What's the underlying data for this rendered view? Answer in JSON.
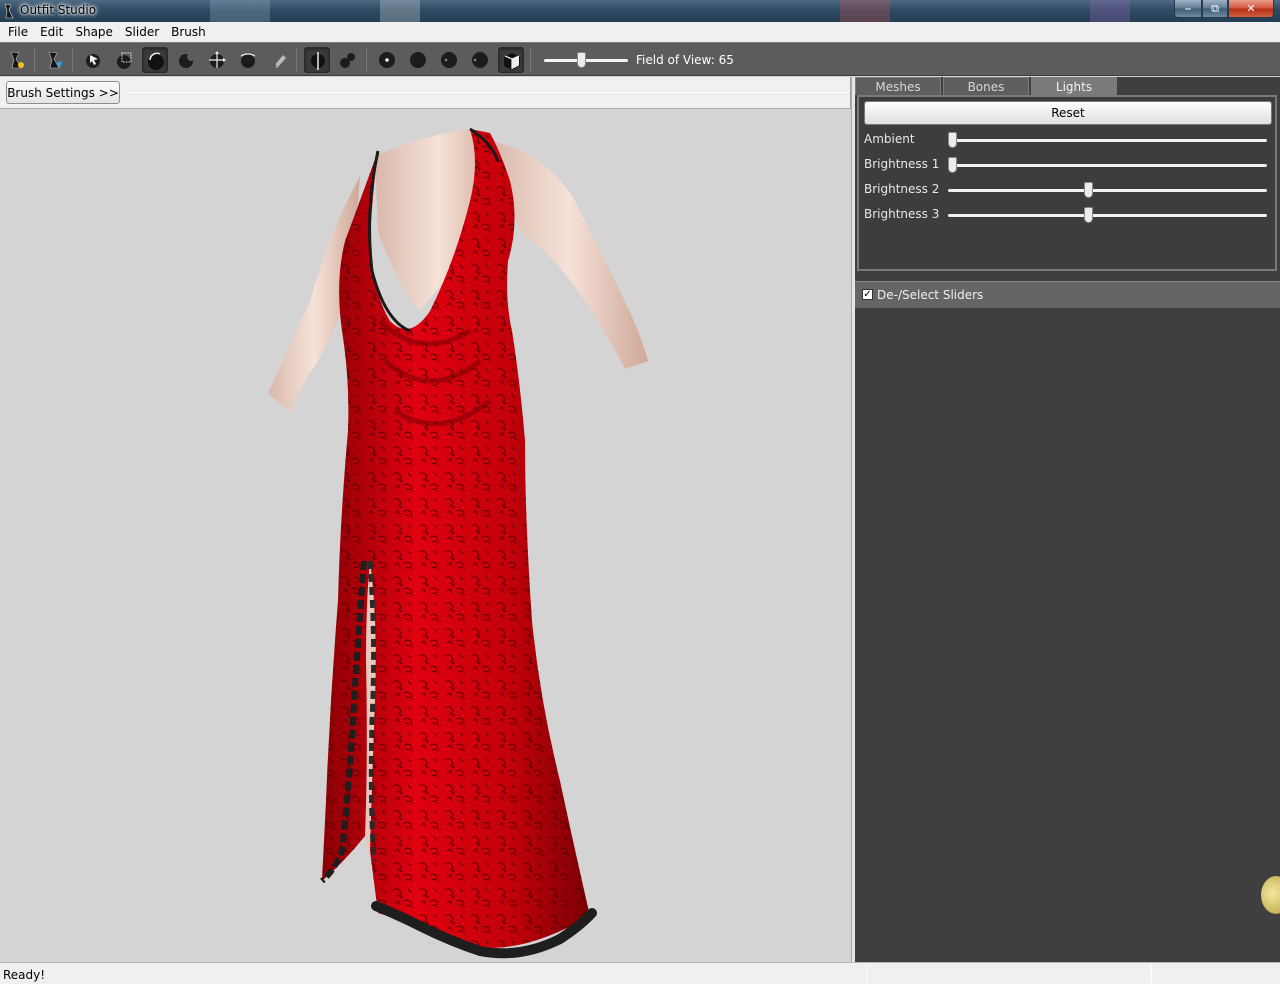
{
  "window": {
    "title": "Outfit Studio"
  },
  "menu": [
    "File",
    "Edit",
    "Shape",
    "Slider",
    "Brush"
  ],
  "toolbar": {
    "icons": [
      "load-reference-icon",
      "load-outfit-icon",
      "select-brush-icon",
      "mask-brush-icon",
      "inflate-brush-icon",
      "deflate-brush-icon",
      "move-brush-icon",
      "smooth-brush-icon",
      "weight-brush-icon",
      "mirror-icon",
      "connected-only-icon",
      "brush-size-small-icon",
      "brush-size-medium-icon",
      "brush-size-large-icon",
      "brush-size-xlarge-icon",
      "view-cube-icon"
    ],
    "field_of_view": {
      "label": "Field of View: 65",
      "value": 65
    }
  },
  "brush_settings_label": "Brush Settings >>",
  "right_panel": {
    "tabs": [
      {
        "label": "Meshes",
        "active": false
      },
      {
        "label": "Bones",
        "active": false
      },
      {
        "label": "Lights",
        "active": true
      }
    ],
    "reset_label": "Reset",
    "lights": [
      {
        "label": "Ambient",
        "value": 0
      },
      {
        "label": "Brightness 1",
        "value": 0
      },
      {
        "label": "Brightness 2",
        "value": 0.44
      },
      {
        "label": "Brightness 3",
        "value": 0.44
      }
    ],
    "sliders_header": {
      "label": "De-/Select Sliders",
      "checked": true
    }
  },
  "status": {
    "text": "Ready!"
  },
  "colors": {
    "viewport_bg": "#d4d4d4",
    "panel_bg": "#3f3f3f",
    "dress": "#c8000a",
    "skin": "#f2d6c8"
  }
}
